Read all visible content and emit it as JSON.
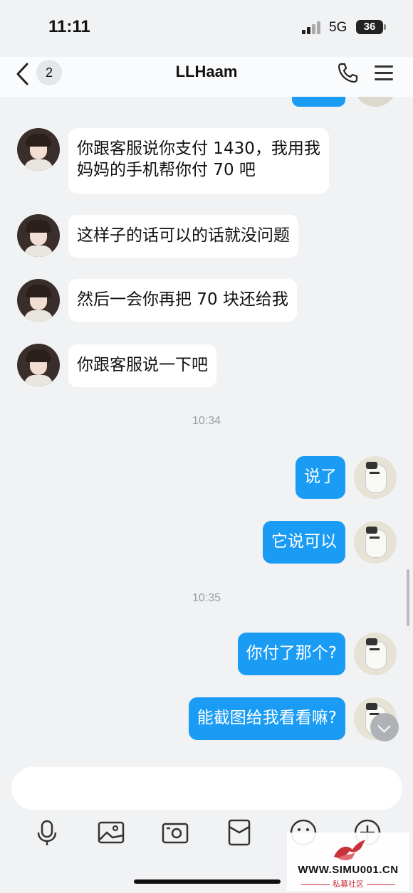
{
  "status_bar": {
    "time": "11:11",
    "network": "5G",
    "battery": "36"
  },
  "header": {
    "back_count": "2",
    "title": "LLHaam"
  },
  "messages": [
    {
      "direction": "in",
      "lines": [
        "你跟客服说你支付 1430，我用我",
        "妈妈的手机帮你付 70 吧"
      ]
    },
    {
      "direction": "in",
      "text": "这样子的话可以的话就没问题"
    },
    {
      "direction": "in",
      "text": "然后一会你再把 70 块还给我"
    },
    {
      "direction": "in",
      "text": "你跟客服说一下吧"
    },
    {
      "timestamp": "10:34"
    },
    {
      "direction": "out",
      "text": "说了"
    },
    {
      "direction": "out",
      "text": "它说可以"
    },
    {
      "timestamp": "10:35"
    },
    {
      "direction": "out",
      "text": "你付了那个?"
    },
    {
      "direction": "out",
      "text": "能截图给我看看嘛?"
    }
  ],
  "toolbar_icons": [
    "microphone-icon",
    "image-icon",
    "camera-icon",
    "red-packet-icon",
    "emoji-icon",
    "plus-icon"
  ],
  "watermark": {
    "url": "WWW.SIMU001.CN",
    "subtitle": "私募社区"
  },
  "colors": {
    "outgoing_bubble": "#1a9cf5",
    "incoming_bubble": "#ffffff",
    "background": "#f1f2f4"
  }
}
